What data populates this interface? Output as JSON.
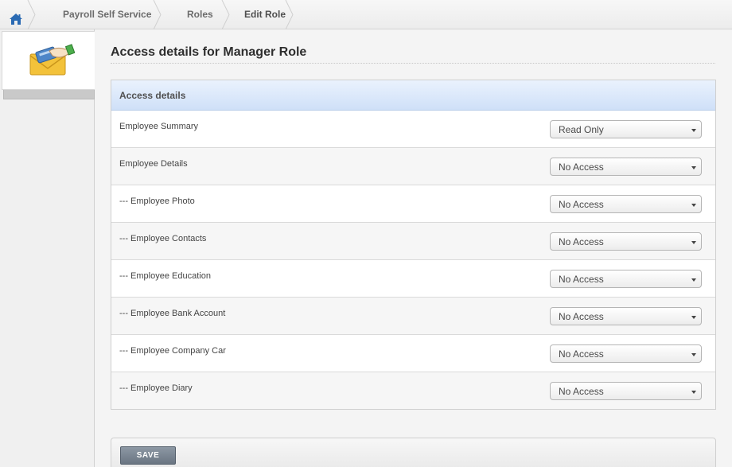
{
  "breadcrumb": {
    "home_icon": "home-icon",
    "items": [
      {
        "label": "Payroll Self Service"
      },
      {
        "label": "Roles"
      },
      {
        "label": "Edit Role"
      }
    ]
  },
  "sidebar": {
    "logo_icon": "payroll-envelope-icon"
  },
  "page": {
    "title": "Access details for Manager Role"
  },
  "access_panel": {
    "header": "Access details",
    "rows": [
      {
        "label": "Employee Summary",
        "value": "Read Only"
      },
      {
        "label": "Employee Details",
        "value": "No Access"
      },
      {
        "label": "--- Employee Photo",
        "value": "No Access"
      },
      {
        "label": "--- Employee Contacts",
        "value": "No Access"
      },
      {
        "label": "--- Employee Education",
        "value": "No Access"
      },
      {
        "label": "--- Employee Bank Account",
        "value": "No Access"
      },
      {
        "label": "--- Employee Company Car",
        "value": "No Access"
      },
      {
        "label": "--- Employee Diary",
        "value": "No Access"
      }
    ]
  },
  "actions": {
    "save_label": "SAVE"
  },
  "colors": {
    "home_icon": "#2a6ab3",
    "panel_header_top": "#eaf2fd",
    "panel_header_bottom": "#cfe0f8",
    "save_button": "#7a8591"
  }
}
